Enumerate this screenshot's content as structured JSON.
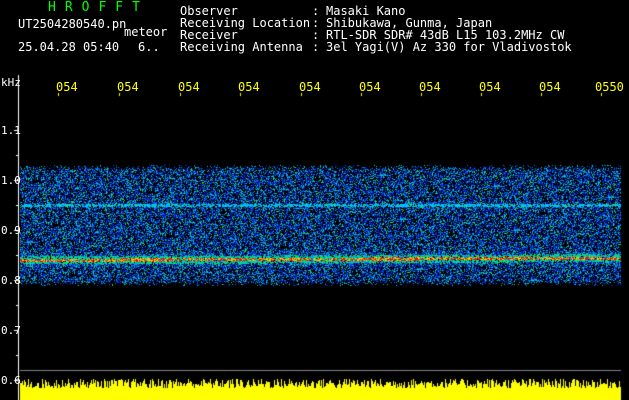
{
  "header": {
    "app_name": "HROFFT",
    "file_name": "UT2504280540.pn",
    "file_suffix": "meteor",
    "date_time": "25.04.28 05:40",
    "extra_code": "6.."
  },
  "info": [
    {
      "label": "Observer",
      "value": "Masaki Kano"
    },
    {
      "label": "Receiving Location",
      "value": "Shibukawa, Gunma, Japan"
    },
    {
      "label": "Receiver",
      "value": "RTL-SDR SDR# 43dB L15 103.2MHz CW"
    },
    {
      "label": "Receiving Antenna",
      "value": "3el Yagi(V) Az 330 for Vladivostok"
    }
  ],
  "chart_data": {
    "type": "heatmap",
    "ylabel": "kHz",
    "yticks": [
      "1.1",
      "1.0",
      "0.9",
      "0.8",
      "0.7",
      "0.6"
    ],
    "yvalues": [
      1.1,
      1.0,
      0.9,
      0.8,
      0.7,
      0.6
    ],
    "xticks": [
      "054",
      "054",
      "054",
      "054",
      "054",
      "054",
      "054",
      "054",
      "054",
      "0550"
    ],
    "ylim": [
      0.6,
      1.1
    ],
    "signal_band": [
      0.8,
      1.02
    ],
    "strong_lines": [
      0.84,
      0.95
    ],
    "colors": {
      "text_green": "#00ff00",
      "tick_yellow": "#ffff00",
      "signal_red": "#ff0000",
      "band_blue": "#1030d0"
    }
  }
}
